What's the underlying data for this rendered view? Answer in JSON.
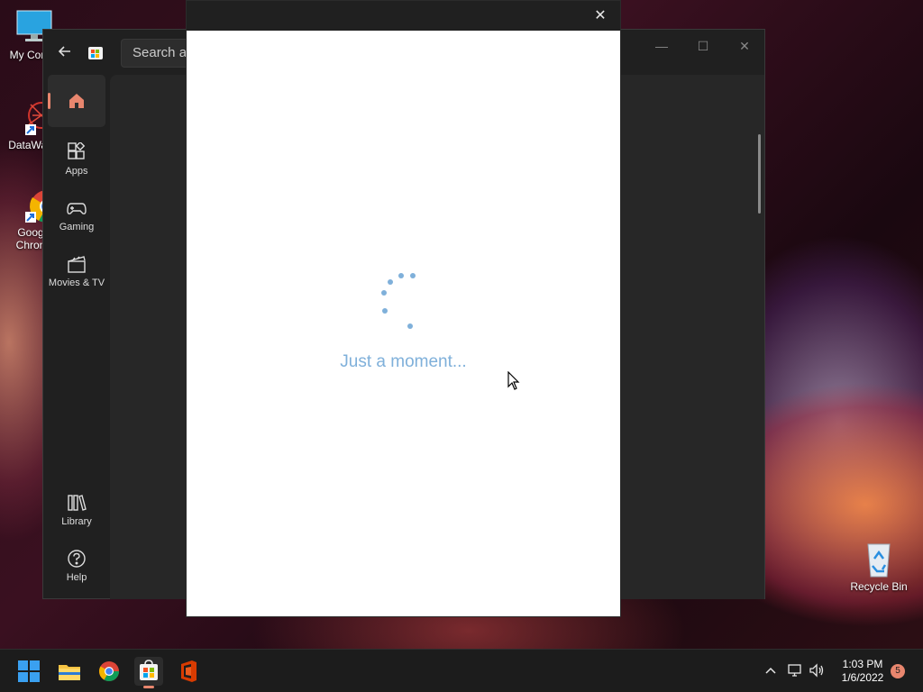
{
  "desktop": {
    "icons": [
      {
        "label": "My Com",
        "icon": "computer-icon"
      },
      {
        "label": "DataWag",
        "icon": "datawagon-icon"
      },
      {
        "label": "Goog Chron",
        "icon": "chrome-icon"
      },
      {
        "label": "Recycle Bin",
        "icon": "recycle-bin-icon"
      }
    ]
  },
  "store": {
    "search_placeholder": "Search ap",
    "nav": [
      {
        "label": "",
        "icon": "home-icon",
        "active": true
      },
      {
        "label": "Apps",
        "icon": "apps-icon"
      },
      {
        "label": "Gaming",
        "icon": "gamepad-icon"
      },
      {
        "label": "Movies & TV",
        "icon": "clapperboard-icon"
      },
      {
        "label": "Library",
        "icon": "library-icon"
      },
      {
        "label": "Help",
        "icon": "help-icon"
      }
    ],
    "window_controls": {
      "minimize": "—",
      "maximize": "☐",
      "close": "✕"
    }
  },
  "dialog": {
    "close_glyph": "✕",
    "loading_text": "Just a moment...",
    "accent": "#7fb0da"
  },
  "taskbar": {
    "apps": [
      "start-icon",
      "file-explorer-icon",
      "chrome-icon",
      "store-icon",
      "office-icon"
    ],
    "tray": {
      "chevron": "^"
    },
    "time": "1:03 PM",
    "date": "1/6/2022",
    "notifications": "5"
  },
  "colors": {
    "accent": "#e8866e",
    "window_bg": "#202020",
    "content_bg": "#272727"
  }
}
